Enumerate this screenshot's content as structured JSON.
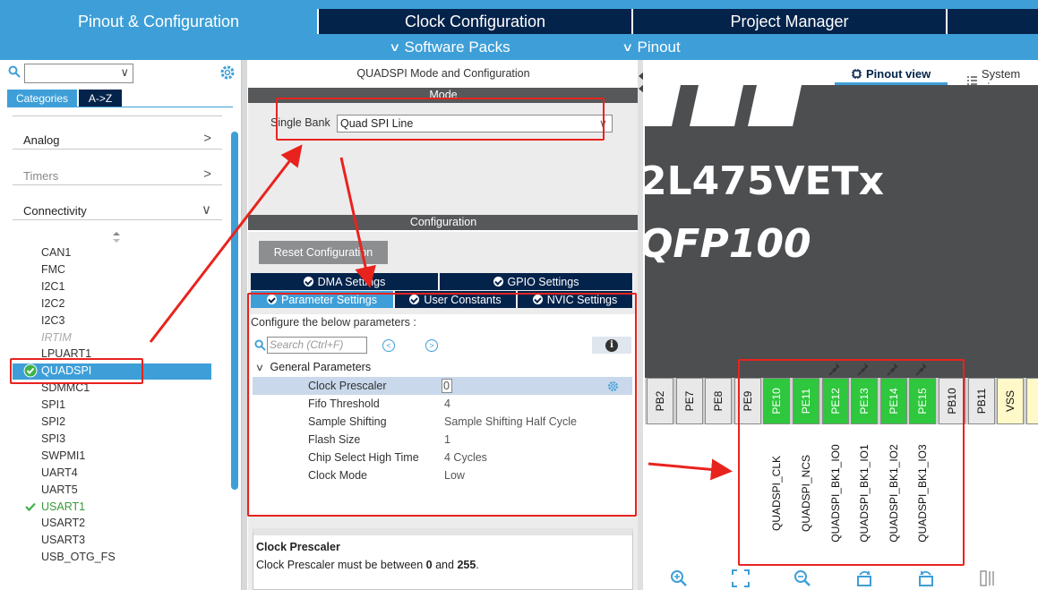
{
  "top_tabs": [
    "Pinout & Configuration",
    "Clock Configuration",
    "Project Manager"
  ],
  "sub_menu": [
    "Software Packs",
    "Pinout"
  ],
  "left": {
    "category_tabs": [
      "Categories",
      "A->Z"
    ],
    "categories": [
      {
        "label": "Analog",
        "chevron": ">",
        "dim": false
      },
      {
        "label": "Timers",
        "chevron": ">",
        "dim": true
      },
      {
        "label": "Connectivity",
        "chevron": "∨",
        "dim": false
      }
    ],
    "peripherals": [
      "CAN1",
      "FMC",
      "I2C1",
      "I2C2",
      "I2C3",
      "IRTIM",
      "LPUART1",
      "QUADSPI",
      "SDMMC1",
      "SPI1",
      "SPI2",
      "SPI3",
      "SWPMI1",
      "UART4",
      "UART5",
      "USART1",
      "USART2",
      "USART3",
      "USB_OTG_FS"
    ],
    "selected": "QUADSPI",
    "enabled": "USART1",
    "disabled": "IRTIM"
  },
  "mid": {
    "title": "QUADSPI Mode and Configuration",
    "mode_header": "Mode",
    "bank_label": "Single Bank",
    "bank_value": "Quad SPI Line",
    "config_header": "Configuration",
    "reset_label": "Reset Configuration",
    "tabs_row1": [
      "DMA Settings",
      "GPIO Settings"
    ],
    "tabs_row2": [
      "Parameter Settings",
      "User Constants",
      "NVIC Settings"
    ],
    "configure_text": "Configure the below parameters :",
    "search_placeholder": "Search (Ctrl+F)",
    "group_label": "General Parameters",
    "params": [
      {
        "key": "Clock Prescaler",
        "value": "0"
      },
      {
        "key": "Fifo Threshold",
        "value": "4"
      },
      {
        "key": "Sample Shifting",
        "value": "Sample Shifting Half Cycle"
      },
      {
        "key": "Flash Size",
        "value": "1"
      },
      {
        "key": "Chip Select High Time",
        "value": "4 Cycles"
      },
      {
        "key": "Clock Mode",
        "value": "Low"
      }
    ],
    "desc_title": "Clock Prescaler",
    "desc_text_pre": "Clock Prescaler must be between ",
    "desc_min": "0",
    "desc_and": " and ",
    "desc_max": "255",
    "desc_end": "."
  },
  "right": {
    "view_tabs": [
      "Pinout view",
      "System vie"
    ],
    "chip_line1": "2L475VETx",
    "chip_line2": "QFP100",
    "pins": [
      "PB2",
      "PE7",
      "PE8",
      "PE9",
      "PE10",
      "PE11",
      "PE12",
      "PE13",
      "PE14",
      "PE15",
      "PB10",
      "PB11",
      "VSS"
    ],
    "green_pins": [
      "PE10",
      "PE11",
      "PE12",
      "PE13",
      "PE14",
      "PE15"
    ],
    "signals": [
      "QUADSPI_CLK",
      "QUADSPI_NCS",
      "QUADSPI_BK1_IO0",
      "QUADSPI_BK1_IO1",
      "QUADSPI_BK1_IO2",
      "QUADSPI_BK1_IO3"
    ]
  },
  "colors": {
    "accent": "#3e9fd8",
    "navy": "#03234b",
    "annotation": "#e8231e",
    "pin_green": "#2fc73d"
  }
}
